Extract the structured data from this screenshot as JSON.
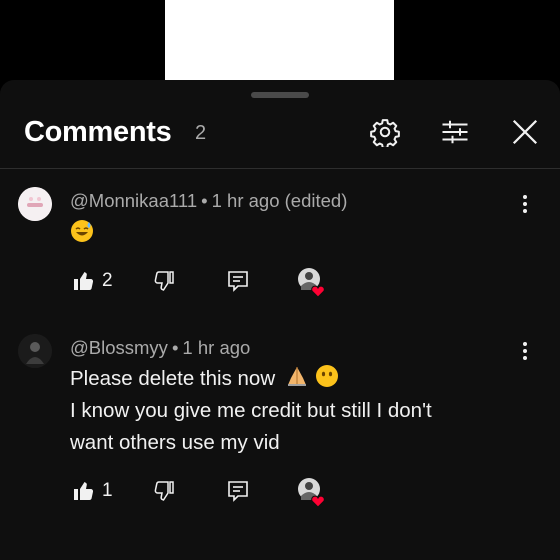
{
  "header": {
    "title": "Comments",
    "count": "2"
  },
  "icons": {
    "settings": "gear-icon",
    "filter": "sliders-icon",
    "close": "close-icon",
    "more": "vertical-dots-icon",
    "like": "thumb-up-icon",
    "dislike": "thumb-down-icon",
    "reply": "reply-icon",
    "creator_heart": "creator-heart-icon"
  },
  "comments": [
    {
      "handle": "@Monnikaa111",
      "time": "1 hr ago (edited)",
      "text": "",
      "emoji": "sweat-smile-emoji",
      "likes": "2"
    },
    {
      "handle": "@Blossmyy",
      "time": "1 hr ago",
      "line1": "Please delete this now",
      "line2": "I know you give me credit but still I don't",
      "line3": "want others use my vid",
      "emoji": "folded-hands-emoji, no-mouth-emoji",
      "likes": "1"
    }
  ],
  "colors": {
    "sheet": "#0f0f0f",
    "muted": "#aaaaaa",
    "heart": "#ff0033"
  }
}
